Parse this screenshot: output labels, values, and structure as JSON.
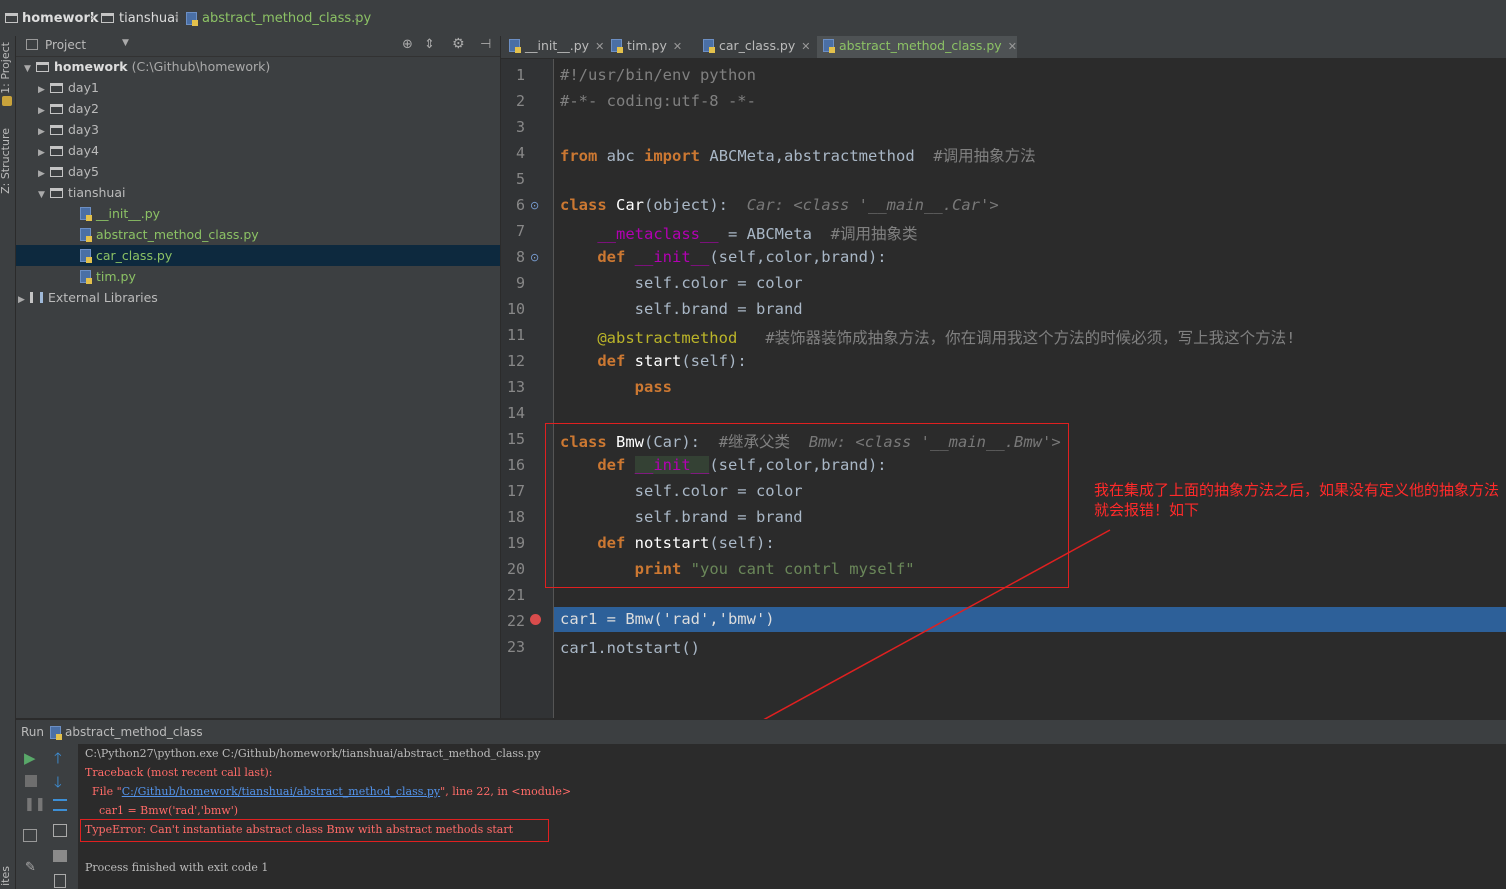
{
  "breadcrumb": {
    "root": "homework",
    "folder": "tianshuai",
    "file": "abstract_method_class.py"
  },
  "left_stripe": {
    "project_tab": "1: Project",
    "structure_tab": "Z: Structure",
    "bottom_tab": "ites"
  },
  "project_panel": {
    "title": "Project",
    "root_name": "homework",
    "root_path": "(C:\\Github\\homework)",
    "folders": [
      "day1",
      "day2",
      "day3",
      "day4",
      "day5"
    ],
    "open_folder": "tianshuai",
    "files": [
      "__init__.py",
      "abstract_method_class.py",
      "car_class.py",
      "tim.py"
    ],
    "selected_file": "car_class.py",
    "external": "External Libraries"
  },
  "tabs": [
    {
      "label": "__init__.py"
    },
    {
      "label": "tim.py"
    },
    {
      "label": "car_class.py"
    },
    {
      "label": "abstract_method_class.py"
    }
  ],
  "editor": {
    "line_numbers": [
      "1",
      "2",
      "3",
      "4",
      "5",
      "6",
      "7",
      "8",
      "9",
      "10",
      "11",
      "12",
      "13",
      "14",
      "15",
      "16",
      "17",
      "18",
      "19",
      "20",
      "21",
      "22",
      "23"
    ],
    "lines": {
      "l1": "#!/usr/bin/env python",
      "l2": "#-*- coding:utf-8 -*-",
      "l4_from": "from",
      "l4_mod": "abc",
      "l4_import": "import",
      "l4_names": "ABCMeta,abstractmethod",
      "l4_comment": "#调用抽象方法",
      "l6_class": "class",
      "l6_name": "Car",
      "l6_rest": "(object):",
      "l6_hint": "Car: <class '__main__.Car'>",
      "l7_meta": "__metaclass__",
      "l7_rest": " = ABCMeta",
      "l7_comment": "#调用抽象类",
      "l8_def": "def",
      "l8_name": "__init__",
      "l8_rest": "(self,color,brand):",
      "l9": "self.color = color",
      "l10": "self.brand = brand",
      "l11_dec": "@abstractmethod",
      "l11_comment": "#装饰器装饰成抽象方法，你在调用我这个方法的时候必须，写上我这个方法!",
      "l12_def": "def",
      "l12_name": "start",
      "l12_rest": "(self):",
      "l13": "pass",
      "l15_class": "class",
      "l15_name": "Bmw",
      "l15_rest": "(Car):",
      "l15_comment": "#继承父类",
      "l15_hint": "Bmw: <class '__main__.Bmw'>",
      "l16_def": "def",
      "l16_name": "__init__",
      "l16_rest": "(self,color,brand):",
      "l17": "self.color = color",
      "l18": "self.brand = brand",
      "l19_def": "def",
      "l19_name": "notstart",
      "l19_rest": "(self):",
      "l20_print": "print",
      "l20_str": "\"you cant contrl myself\"",
      "l22": "car1 = Bmw('rad','bmw')",
      "l23": "car1.notstart()"
    }
  },
  "annotation": "我在集成了上面的抽象方法之后，如果没有定义他的抽象方法就会报错！如下",
  "run_panel": {
    "label": "Run",
    "config": "abstract_method_class",
    "console": {
      "cmd": "C:\\Python27\\python.exe C:/Github/homework/tianshuai/abstract_method_class.py",
      "traceback": "Traceback (most recent call last):",
      "file_prefix": "  File \"",
      "file_link": "C:/Github/homework/tianshuai/abstract_method_class.py",
      "file_suffix": "\", line 22, in <module>",
      "code": "    car1 = Bmw('rad','bmw')",
      "error": "TypeError: Can't instantiate abstract class Bmw with abstract methods start",
      "finished": "Process finished with exit code 1"
    }
  },
  "colors": {
    "keyword": "#cc7832",
    "selection": "#2d6099",
    "annotation_red": "#ff2a2a",
    "green_file": "#8cc265"
  }
}
